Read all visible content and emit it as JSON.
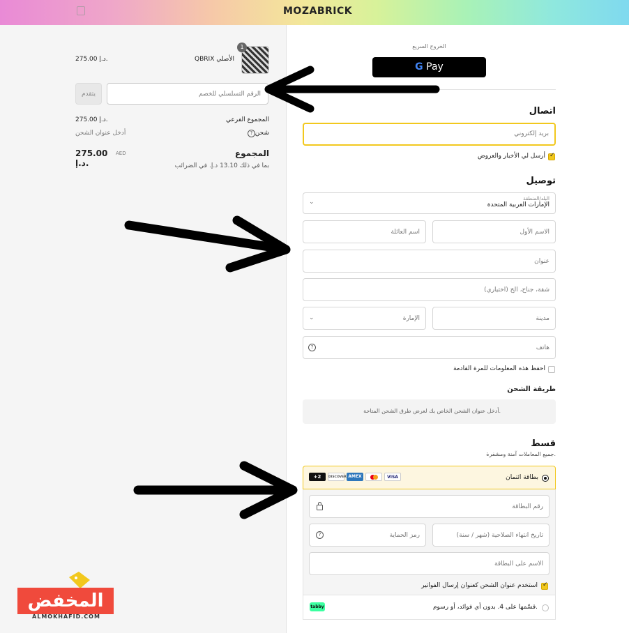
{
  "header": {
    "logo": "MOZABRICK",
    "bag_icon": "shopping-bag-icon"
  },
  "summary": {
    "product": {
      "name": "QBRIX الأصلي",
      "price": "275.00 د.إ.",
      "quantity": "1"
    },
    "discount": {
      "placeholder": "الرقم التسلسلي للخصم",
      "button": "يتقدم"
    },
    "subtotal": {
      "label": "المجموع الفرعي",
      "value": "275.00 د.إ."
    },
    "shipping": {
      "label": "شحن",
      "value": "أدخل عنوان الشحن"
    },
    "total": {
      "label": "المجموع",
      "currency": "AED",
      "value": "275.00 د.إ.",
      "tax_note": "بما في ذلك 13.10 د.إ. في الضرائب"
    }
  },
  "express": {
    "label": "الخروج السريع",
    "gpay": "Pay",
    "g": "G"
  },
  "contact": {
    "title": "اتصال",
    "email_placeholder": "بريد إلكتروني",
    "newsletter": "أرسل لي الأخبار والعروض"
  },
  "delivery": {
    "title": "توصيل",
    "country_label": "البلد/المنطقة",
    "country_value": "الإمارات العربية المتحدة",
    "first_name": "الاسم الأول",
    "last_name": "اسم العائلة",
    "address": "عنوان",
    "apartment": "شقة، جناح، الخ (اختياري)",
    "city": "مدينة",
    "emirate": "الإمارة",
    "phone": "هاتف",
    "save_info": "احفظ هذه المعلومات للمرة القادمة"
  },
  "shipping_method": {
    "title": "طريقة الشحن",
    "note": "أدخل عنوان الشحن الخاص بك لعرض طرق الشحن المتاحة."
  },
  "payment": {
    "title": "قسط",
    "subtitle": "جميع المعاملات آمنة ومشفرة.",
    "credit_card": "بطاقة ائتمان",
    "card_logos": [
      "VISA",
      "",
      "AMEX",
      "DISCOVER",
      "+2"
    ],
    "card_number": "رقم البطاقة",
    "expiry": "تاريخ انتهاء الصلاحية (شهر / سنة)",
    "cvv": "رمز الحماية",
    "name_on_card": "الاسم على البطاقة",
    "use_shipping": "استخدم عنوان الشحن كعنوان إرسال الفواتير",
    "tabby_text": "قسّمها على 4. بدون أي فوائد، أو رسوم.",
    "tabby_logo": "tabby"
  },
  "watermark": {
    "text": "المخفض",
    "url": "ALMOKHAFID.COM"
  },
  "colors": {
    "accent": "#f2c81d",
    "watermark": "#f04a3c"
  }
}
